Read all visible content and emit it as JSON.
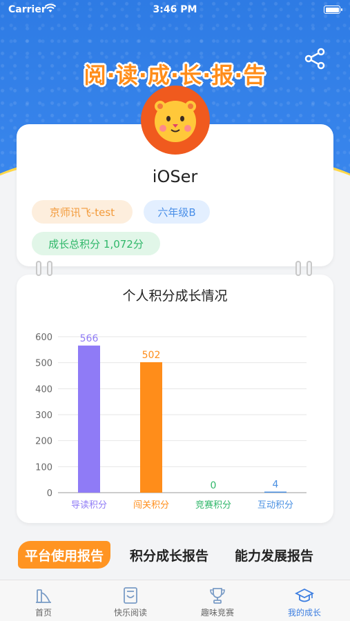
{
  "status_bar": {
    "carrier": "Carrier",
    "time": "3:46 PM"
  },
  "header": {
    "title": "阅·读·成·长·报·告"
  },
  "profile": {
    "username": "iOSer",
    "school_tag": "京师讯飞-test",
    "class_tag": "六年级B",
    "score_tag": "成长总积分 1,072分"
  },
  "chart": {
    "title": "个人积分成长情况"
  },
  "chart_data": {
    "type": "bar",
    "categories": [
      "导读积分",
      "闯关积分",
      "竞赛积分",
      "互动积分"
    ],
    "values": [
      566,
      502,
      0,
      4
    ],
    "colors": [
      "#8f7bf6",
      "#ff8d1a",
      "#2fb769",
      "#4a90e2"
    ],
    "yticks": [
      0,
      100,
      200,
      300,
      400,
      500,
      600
    ],
    "ylim": [
      0,
      600
    ],
    "grid": true
  },
  "report_tabs": [
    "平台使用报告",
    "积分成长报告",
    "能力发展报告"
  ],
  "bottom_nav": [
    {
      "label": "首页",
      "icon": "home-slide-icon"
    },
    {
      "label": "快乐阅读",
      "icon": "book-icon"
    },
    {
      "label": "趣味竞赛",
      "icon": "trophy-icon"
    },
    {
      "label": "我的成长",
      "icon": "graduation-cap-icon"
    }
  ],
  "colors": {
    "accent": "#ff9422",
    "header_blue": "#2f7de6",
    "nav_active": "#3b7de0"
  }
}
